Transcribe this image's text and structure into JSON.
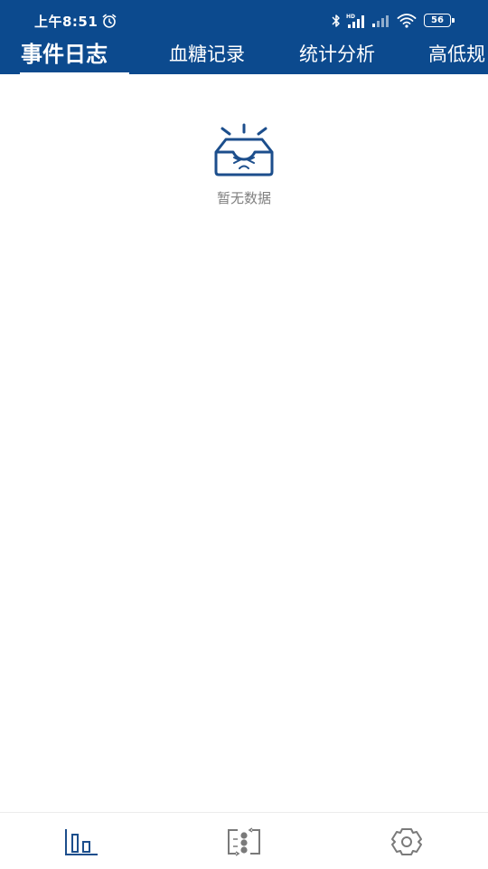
{
  "status_bar": {
    "time": "上午8:51",
    "battery": "56"
  },
  "tabs": [
    {
      "label": "事件日志",
      "active": true
    },
    {
      "label": "血糖记录",
      "active": false
    },
    {
      "label": "统计分析",
      "active": false
    },
    {
      "label": "高低规",
      "active": false
    }
  ],
  "empty_state": {
    "message": "暂无数据",
    "icon": "empty-inbox-icon"
  },
  "bottom_nav": [
    {
      "icon": "bar-chart-icon",
      "active": true
    },
    {
      "icon": "swap-transfer-icon",
      "active": false
    },
    {
      "icon": "settings-gear-icon",
      "active": false
    }
  ],
  "colors": {
    "brand": "#0c4a8e",
    "icon_active": "#1c4e8c",
    "icon_inactive": "#7a7a7a",
    "text_muted": "#808080"
  }
}
